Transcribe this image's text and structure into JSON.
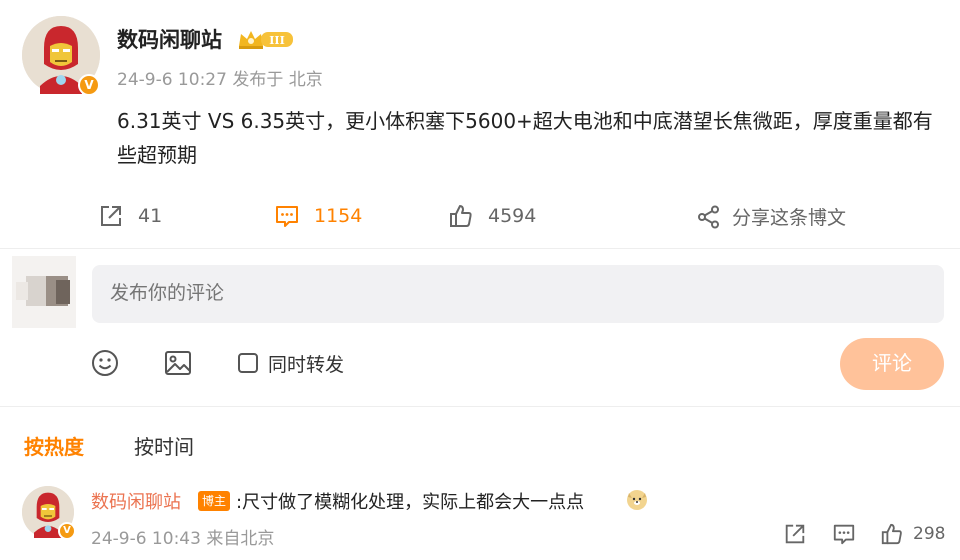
{
  "post": {
    "author": "数码闲聊站",
    "timestamp": "24-9-6 10:27",
    "source": "发布于 北京",
    "text": "6.31英寸 VS 6.35英寸，更小体积塞下5600+超大电池和中底潜望长焦微距，厚度重量都有些超预期",
    "verified_badge": "V",
    "crown_level": "III",
    "repost_count": "41",
    "comment_count": "1154",
    "like_count": "4594",
    "share_label": "分享这条博文"
  },
  "composer": {
    "placeholder": "发布你的评论",
    "repost_label": "同时转发",
    "submit_label": "评论"
  },
  "sort": {
    "hot_label": "按热度",
    "time_label": "按时间"
  },
  "comment": {
    "author": "数码闲聊站",
    "tag": "博主",
    "text": ":尺寸做了模糊化处理，实际上都会大一点点",
    "timestamp": "24-9-6 10:43",
    "source": "来自北京",
    "like_count": "298",
    "verified_badge": "V"
  },
  "colors": {
    "accent": "#ff8200",
    "submit_disabled": "#ffc29a",
    "author_link": "#eb7350",
    "muted": "#999999"
  }
}
